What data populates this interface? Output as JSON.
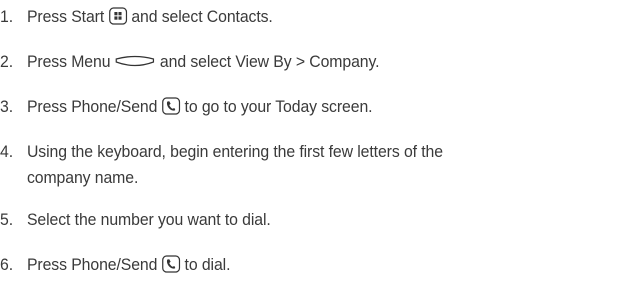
{
  "steps": [
    {
      "number": "1.",
      "before": "Press Start",
      "icon": "start-key-icon",
      "after": "and select Contacts."
    },
    {
      "number": "2.",
      "before": "Press Menu",
      "icon": "menu-key-icon",
      "after": "and select View By > Company."
    },
    {
      "number": "3.",
      "before": "Press Phone/Send",
      "icon": "phone-send-key-icon",
      "after": "to go to your Today screen."
    },
    {
      "number": "4.",
      "line1": "Using the keyboard, begin entering the first few letters of the",
      "line2": "company name."
    },
    {
      "number": "5.",
      "text": "Select the number you want to dial."
    },
    {
      "number": "6.",
      "before": "Press Phone/Send",
      "icon": "phone-send-key-icon",
      "after": "to dial."
    }
  ],
  "colors": {
    "text": "#3a3a3a",
    "icon_stroke": "#333333"
  }
}
